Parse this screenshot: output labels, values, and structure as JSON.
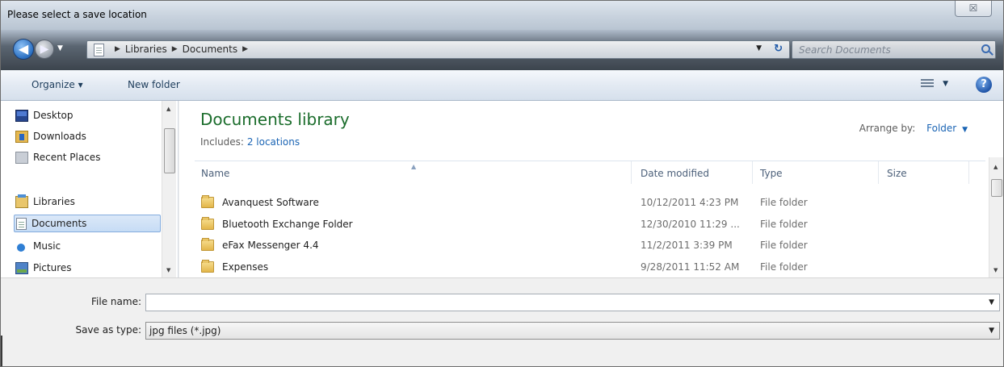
{
  "window": {
    "title": "Please select a save location",
    "close_glyph": "☒"
  },
  "address": {
    "crumbs": [
      "Libraries",
      "Documents"
    ],
    "search_placeholder": "Search Documents"
  },
  "toolbar": {
    "organize_label": "Organize ▾",
    "new_folder_label": "New folder",
    "help_glyph": "?"
  },
  "nav": {
    "items": [
      {
        "label": "Desktop",
        "icon": "desktop-icon"
      },
      {
        "label": "Downloads",
        "icon": "downloads-icon"
      },
      {
        "label": "Recent Places",
        "icon": "recent-places-icon"
      },
      {
        "label": "Libraries",
        "icon": "libraries-icon"
      },
      {
        "label": "Documents",
        "icon": "documents-icon",
        "selected": true
      },
      {
        "label": "Music",
        "icon": "music-icon"
      },
      {
        "label": "Pictures",
        "icon": "pictures-icon"
      }
    ]
  },
  "library": {
    "title": "Documents library",
    "includes_label": "Includes:",
    "includes_link": "2 locations",
    "arrange_label": "Arrange by:",
    "arrange_value": "Folder"
  },
  "columns": {
    "name": "Name",
    "date": "Date modified",
    "type": "Type",
    "size": "Size"
  },
  "files": [
    {
      "name": "Avanquest Software",
      "date": "10/12/2011 4:23 PM",
      "type": "File folder"
    },
    {
      "name": "Bluetooth Exchange Folder",
      "date": "12/30/2010 11:29 ...",
      "type": "File folder"
    },
    {
      "name": "eFax Messenger 4.4",
      "date": "11/2/2011 3:39 PM",
      "type": "File folder"
    },
    {
      "name": "Expenses",
      "date": "9/28/2011 11:52 AM",
      "type": "File folder"
    }
  ],
  "form": {
    "filename_label": "File name:",
    "filename_value": "",
    "savetype_label": "Save as type:",
    "savetype_value": "jpg files (*.jpg)"
  },
  "colors": {
    "library_title": "#1b6d2c",
    "link": "#1a64b4",
    "selection": "#c6dcf5"
  }
}
